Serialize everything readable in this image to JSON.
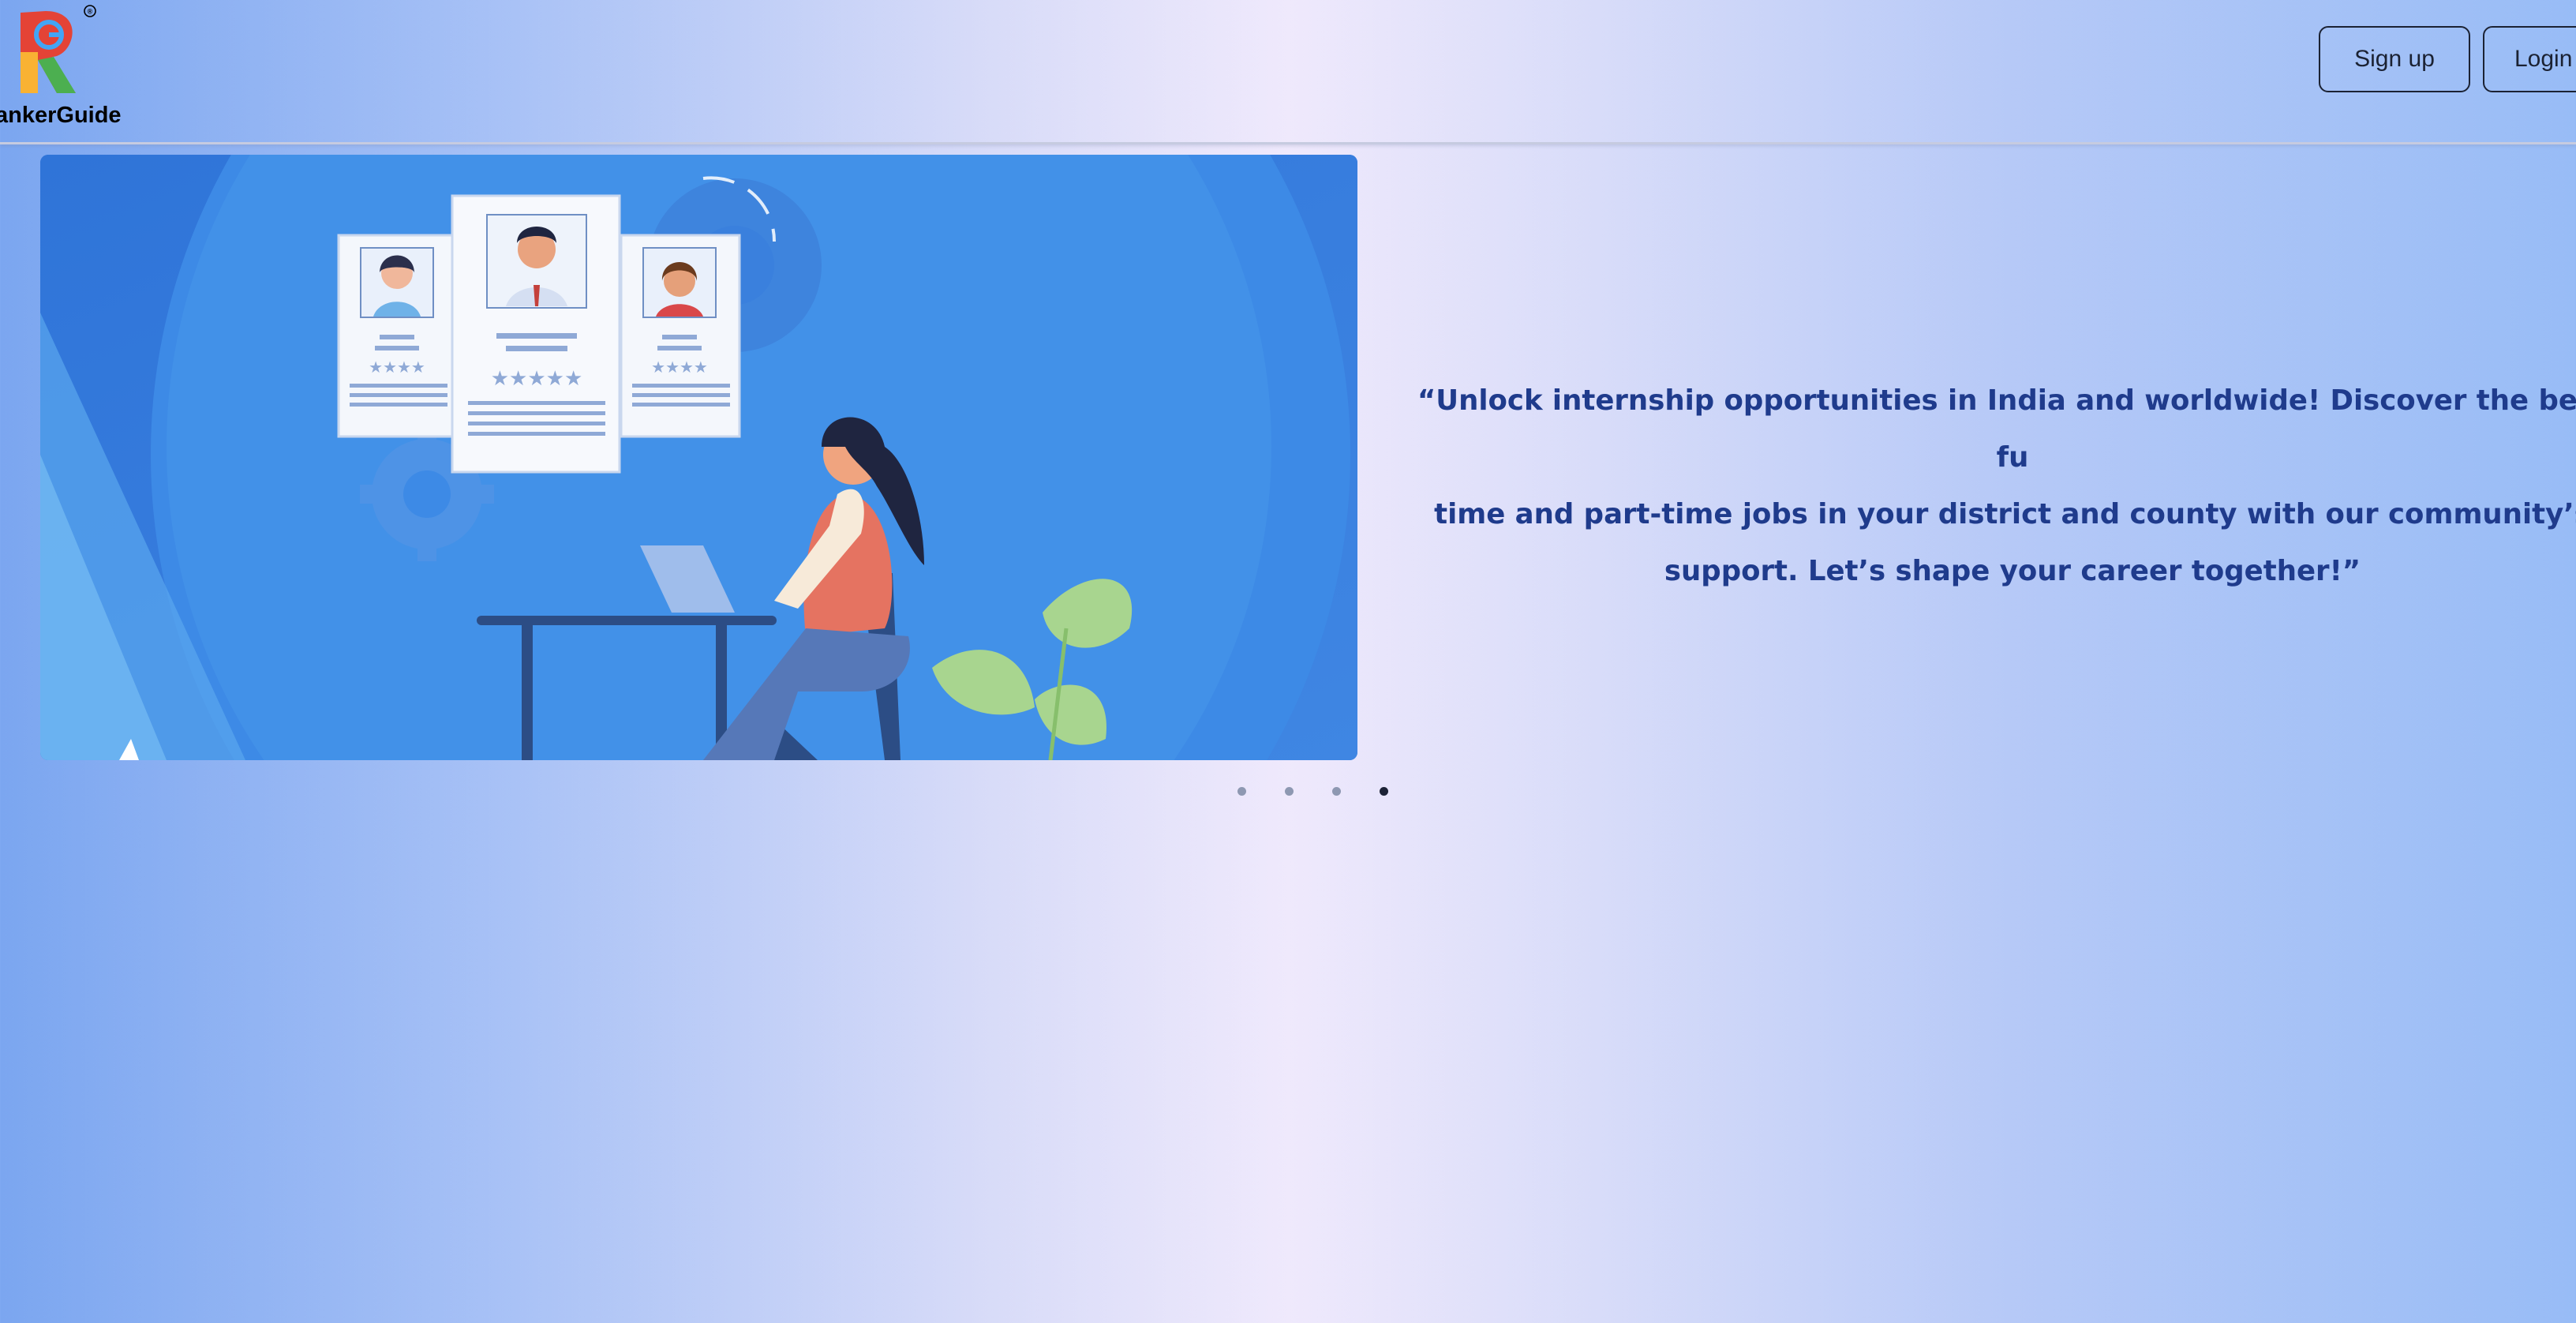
{
  "brand": {
    "name": "ankerGuide",
    "registered_mark": "®"
  },
  "nav": {
    "signup_label": "Sign up",
    "login_label": "Login"
  },
  "hero": {
    "tagline_line1": "“Unlock internship opportunities in India and worldwide! Discover the best fu",
    "tagline_line2": "time and part-time jobs in your district and county with our community’s",
    "tagline_line3": "support. Let’s shape your career together!”",
    "illustration": "woman-at-laptop-with-candidate-profile-cards"
  },
  "carousel": {
    "slide_count": 4,
    "active_index": 3
  },
  "colors": {
    "tagline": "#1f3b8c",
    "illustration_bg": "#3b7fdd",
    "dot_inactive": "#8e98b2",
    "dot_active": "#1c2236"
  }
}
